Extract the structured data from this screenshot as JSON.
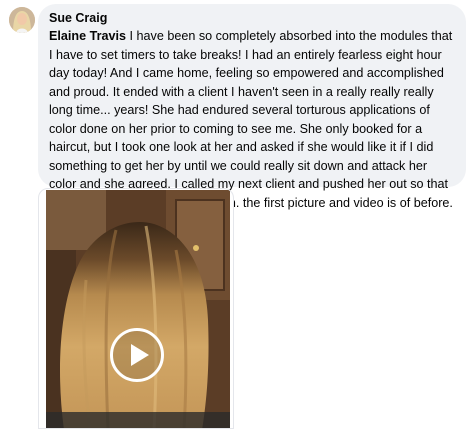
{
  "comment": {
    "author": "Sue Craig",
    "mention": "Elaine Travis",
    "text": " I have been so completely absorbed into the modules that I have to set timers to take breaks! I had an entirely fearless eight hour day today! And I came home, feeling so empowered and accomplished and proud. It ended with a client I haven't seen in a really really really long time... years! She had endured several torturous applications of color done on her prior to coming to see me. She only booked for a haircut, but I took one look at her and asked if she would like it if I did something to get her by until we could really sit down and attack her color and she agreed. I called my next client and pushed her out so that I could accommodate this woman. the first picture and video is of before."
  },
  "media": {
    "type": "video",
    "play_icon": "play-icon"
  },
  "colors": {
    "bubble_background": "#f0f2f5",
    "text": "#050505",
    "card_border": "#e4e6eb"
  }
}
